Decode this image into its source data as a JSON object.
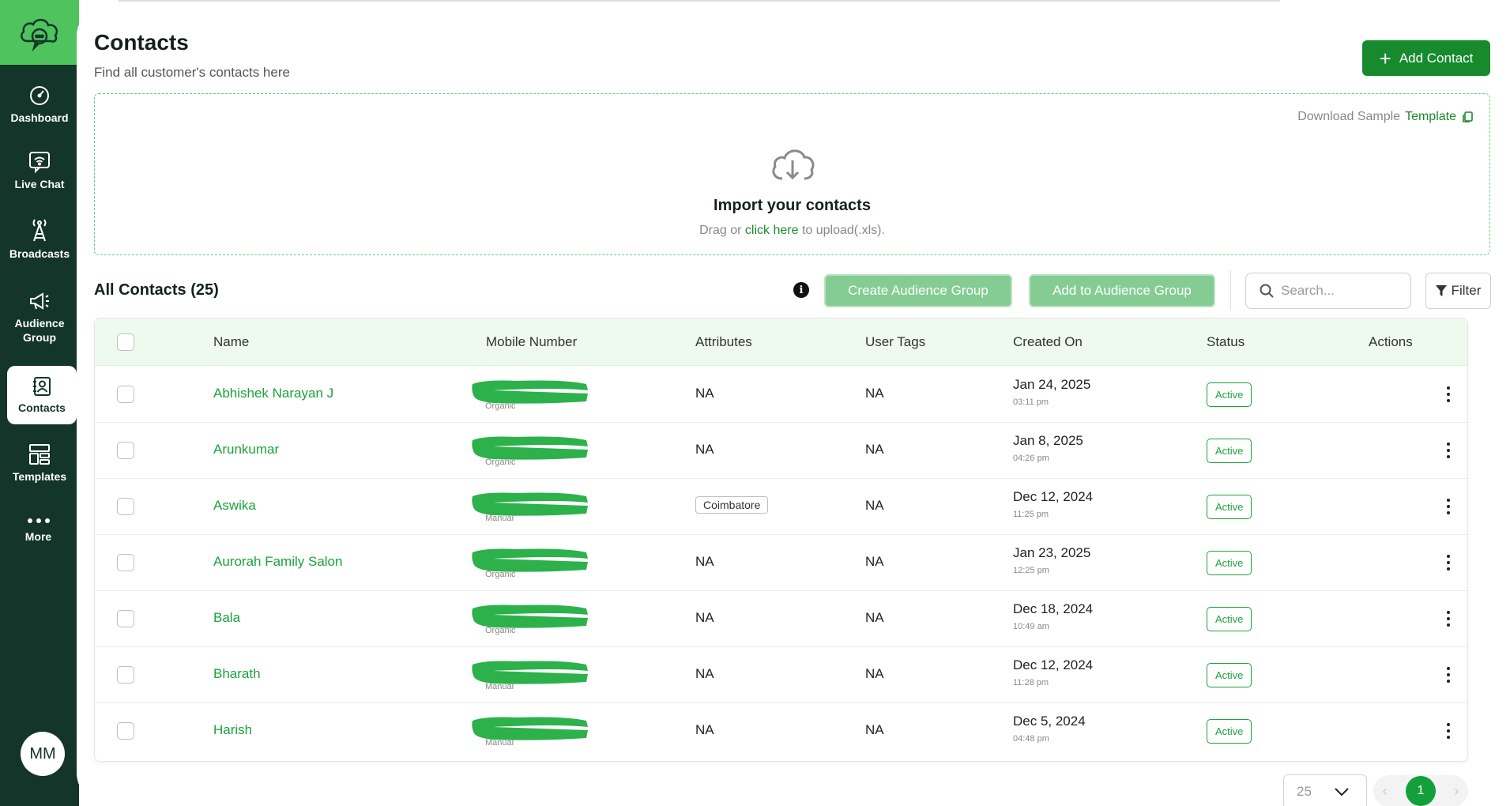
{
  "sidebar": {
    "items": [
      {
        "label": "Dashboard"
      },
      {
        "label": "Live Chat"
      },
      {
        "label": "Broadcasts"
      },
      {
        "label": "Audience Group"
      },
      {
        "label": "Contacts"
      },
      {
        "label": "Templates"
      },
      {
        "label": "More"
      }
    ],
    "active": "Contacts",
    "avatar_initials": "MM"
  },
  "header": {
    "title": "Contacts",
    "subtitle": "Find all customer's contacts here",
    "add_button": "Add Contact"
  },
  "import": {
    "download_prefix": "Download Sample",
    "download_link": "Template",
    "title": "Import your contacts",
    "sub_prefix": "Drag or",
    "sub_link": "click here",
    "sub_suffix": "to upload(.xls)."
  },
  "toolbar": {
    "all_contacts": "All Contacts (25)",
    "create_group": "Create Audience Group",
    "add_to_group": "Add to Audience Group",
    "search_placeholder": "Search...",
    "filter": "Filter"
  },
  "table": {
    "columns": [
      "Name",
      "Mobile Number",
      "Attributes",
      "User Tags",
      "Created On",
      "Status",
      "Actions"
    ],
    "rows": [
      {
        "name": "Abhishek Narayan J",
        "source": "Organic",
        "attribute": "NA",
        "user_tags": "NA",
        "date": "Jan 24, 2025",
        "time": "03:11 pm",
        "status": "Active"
      },
      {
        "name": "Arunkumar",
        "source": "Organic",
        "attribute": "NA",
        "user_tags": "NA",
        "date": "Jan 8, 2025",
        "time": "04:26 pm",
        "status": "Active"
      },
      {
        "name": "Aswika",
        "source": "Manual",
        "attribute": "Coimbatore",
        "user_tags": "NA",
        "date": "Dec 12, 2024",
        "time": "11:25 pm",
        "status": "Active"
      },
      {
        "name": "Aurorah Family Salon",
        "source": "Organic",
        "attribute": "NA",
        "user_tags": "NA",
        "date": "Jan 23, 2025",
        "time": "12:25 pm",
        "status": "Active"
      },
      {
        "name": "Bala",
        "source": "Organic",
        "attribute": "NA",
        "user_tags": "NA",
        "date": "Dec 18, 2024",
        "time": "10:49 am",
        "status": "Active"
      },
      {
        "name": "Bharath",
        "source": "Manual",
        "attribute": "NA",
        "user_tags": "NA",
        "date": "Dec 12, 2024",
        "time": "11:28 pm",
        "status": "Active"
      },
      {
        "name": "Harish",
        "source": "Manual",
        "attribute": "NA",
        "user_tags": "NA",
        "date": "Dec 5, 2024",
        "time": "04:48 pm",
        "status": "Active"
      }
    ]
  },
  "pagination": {
    "per_page": "25",
    "current_page": "1"
  },
  "colors": {
    "sidebar_bg": "#14352a",
    "brand_green": "#168a2c",
    "light_green_button": "#85cc93",
    "header_row_bg": "#effaee",
    "phone_redaction": "#2db14b"
  },
  "icons": {
    "add": "plus-icon",
    "copy": "copy-icon",
    "upload": "cloud-download-icon",
    "info": "info-icon",
    "search": "search-icon",
    "filter": "filter-icon",
    "row_actions": "kebab-menu-icon"
  }
}
